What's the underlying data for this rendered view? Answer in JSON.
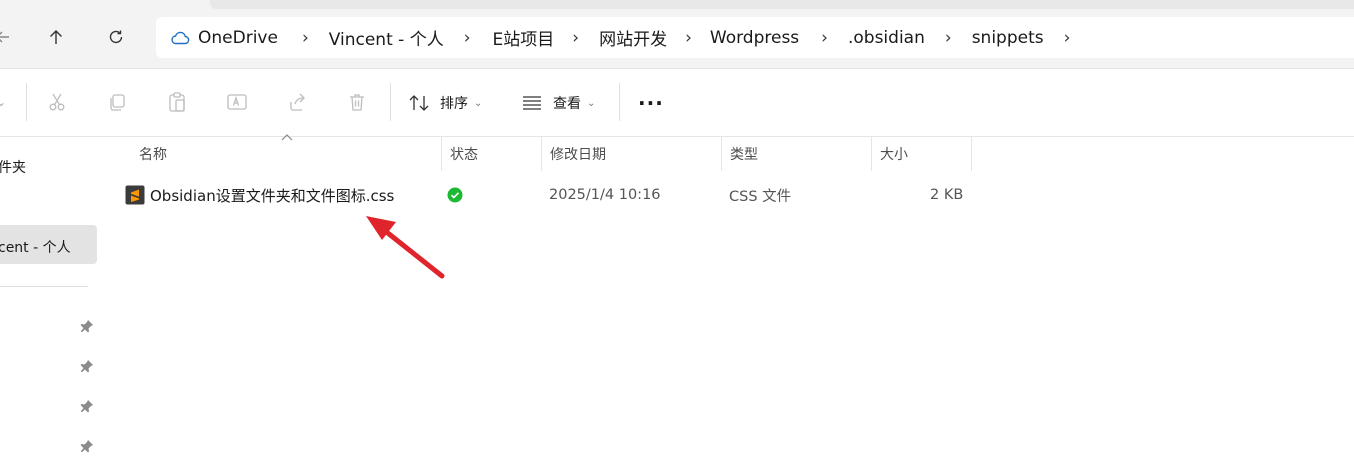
{
  "address_bar": {
    "crumbs": [
      "OneDrive",
      "Vincent - 个人",
      "E站项目",
      "网站开发",
      "Wordpress",
      ".obsidian",
      "snippets"
    ],
    "cloud_icon": "cloud-icon",
    "separator_icon": "chevron-right-icon"
  },
  "nav_buttons": [
    "arrow-left-icon",
    "arrow-up-icon",
    "refresh-icon"
  ],
  "toolbar": {
    "icons": [
      "cut-icon",
      "copy-icon",
      "paste-icon",
      "rename-icon",
      "share-icon",
      "delete-icon"
    ],
    "sort_label": "排序",
    "view_label": "查看",
    "more_label": "···"
  },
  "navpane": {
    "item_folders": "件夹",
    "item_onedrive": "cent - 个人"
  },
  "columns": {
    "name": "名称",
    "status": "状态",
    "modified": "修改日期",
    "type": "类型",
    "size": "大小"
  },
  "files": [
    {
      "name": "Obsidian设置文件夹和文件图标.css",
      "status": "synced",
      "modified": "2025/1/4 10:16",
      "type": "CSS 文件",
      "size": "2 KB",
      "icon": "sublime-css-file-icon"
    }
  ],
  "colors": {
    "accent_status": "#1db834",
    "annotation_arrow": "#e0242b",
    "file_icon_bg": "#3b3b3b",
    "file_icon_fg": "#ff9800"
  }
}
